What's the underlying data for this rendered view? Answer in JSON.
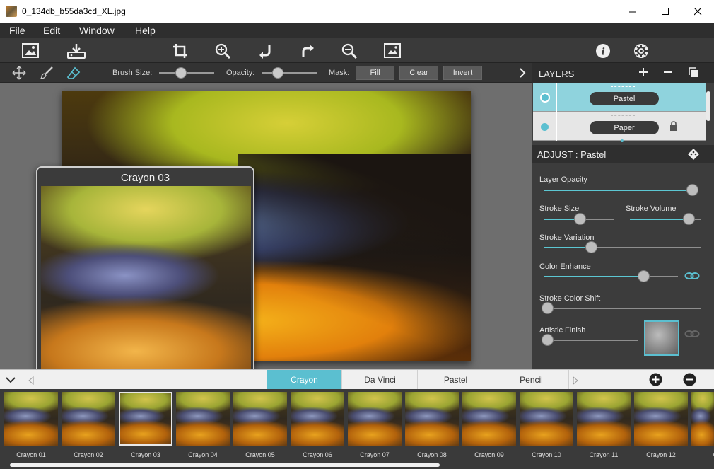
{
  "window": {
    "title": "0_134db_b55da3cd_XL.jpg"
  },
  "menu": [
    "File",
    "Edit",
    "Window",
    "Help"
  ],
  "options": {
    "brush_size_label": "Brush Size:",
    "opacity_label": "Opacity:",
    "mask_label": "Mask:",
    "fill": "Fill",
    "clear": "Clear",
    "invert": "Invert",
    "brush_size": 0.4,
    "opacity": 0.3
  },
  "popup": {
    "title": "Crayon 03"
  },
  "layers": {
    "title": "LAYERS",
    "items": [
      {
        "name": "Pastel",
        "selected": true,
        "locked": false
      },
      {
        "name": "Paper",
        "selected": false,
        "locked": true
      }
    ]
  },
  "adjust": {
    "title": "ADJUST : Pastel",
    "layer_opacity": {
      "label": "Layer Opacity",
      "value": 1.0
    },
    "stroke_size": {
      "label": "Stroke Size",
      "value": 0.5
    },
    "stroke_volume": {
      "label": "Stroke Volume",
      "value": 0.83
    },
    "stroke_variation": {
      "label": "Stroke Variation",
      "value": 0.3
    },
    "color_enhance": {
      "label": "Color Enhance",
      "value": 0.74
    },
    "stroke_color_shift": {
      "label": "Stroke Color Shift",
      "value": 0.0
    },
    "artistic_finish": {
      "label": "Artistic Finish",
      "value": 0.0
    }
  },
  "tabs": [
    {
      "label": "Crayon",
      "active": true
    },
    {
      "label": "Da Vinci",
      "active": false
    },
    {
      "label": "Pastel",
      "active": false
    },
    {
      "label": "Pencil",
      "active": false
    }
  ],
  "thumbnails": [
    "Crayon 01",
    "Crayon 02",
    "Crayon 03",
    "Crayon 04",
    "Crayon 05",
    "Crayon 06",
    "Crayon 07",
    "Crayon 08",
    "Crayon 09",
    "Crayon 10",
    "Crayon 11",
    "Crayon 12",
    "Cra"
  ],
  "selected_thumbnail": "Crayon 03",
  "colors": {
    "accent": "#5bbfd0",
    "panel": "#3f3f3f",
    "canvas_bg": "#6e6e6e"
  }
}
